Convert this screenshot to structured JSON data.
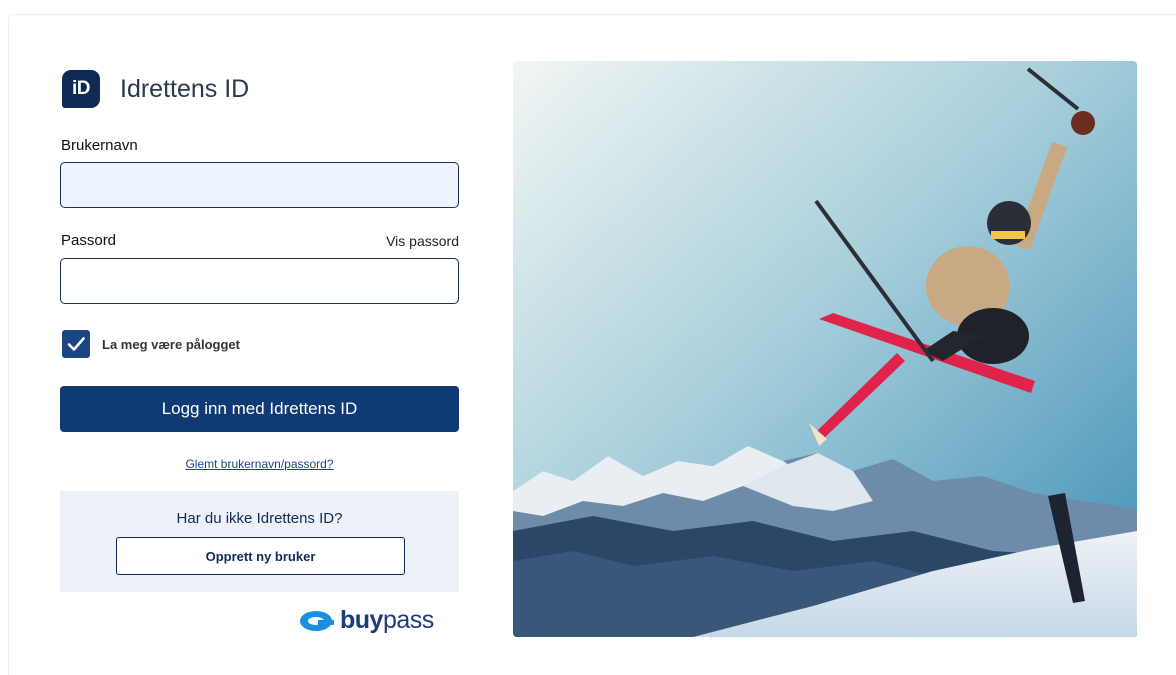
{
  "brand": {
    "badge": "iD",
    "name": "Idrettens ID"
  },
  "form": {
    "username_label": "Brukernavn",
    "username_value": "",
    "password_label": "Passord",
    "password_value": "",
    "show_password": "Vis passord",
    "remember_label": "La meg være pålogget",
    "remember_checked": true,
    "login_button": "Logg inn med Idrettens ID",
    "forgot_link": "Glemt brukernavn/passord?"
  },
  "signup": {
    "question": "Har du ikke Idrettens ID?",
    "button": "Opprett ny bruker"
  },
  "footer": {
    "provider_bold": "buy",
    "provider_rest": "pass"
  },
  "colors": {
    "primary": "#0f3a73",
    "navy": "#0f2b55",
    "checkbox": "#1b4584",
    "input_fill": "#eef4fd",
    "signup_bg": "#edf2f9"
  },
  "photo": {
    "subject": "skier-jumping-mountains"
  }
}
